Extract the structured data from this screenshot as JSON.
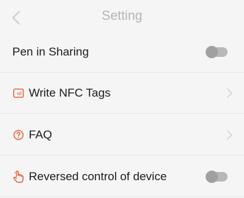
{
  "header": {
    "title": "Setting",
    "back_icon": "chevron-left-icon"
  },
  "rows": [
    {
      "label": "Pen in Sharing",
      "control": "toggle",
      "state": "off"
    },
    {
      "label": "Write NFC Tags",
      "icon": "nfc-icon",
      "control": "chevron"
    },
    {
      "label": "FAQ",
      "icon": "question-circle-icon",
      "control": "chevron"
    },
    {
      "label": "Reversed control of device",
      "icon": "hand-pointer-icon",
      "control": "toggle",
      "state": "off"
    }
  ],
  "colors": {
    "background": "#f5f5f5",
    "accent": "#e0552a",
    "title": "#b5b5b5",
    "toggle_off": "#b8b8b8"
  }
}
